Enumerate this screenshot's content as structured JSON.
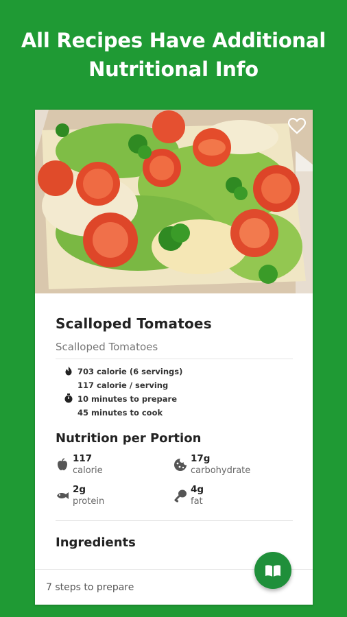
{
  "promo": {
    "line1": "All Recipes Have Additional",
    "line2": "Nutritional Info"
  },
  "recipe": {
    "title": "Scalloped Tomatoes",
    "subtitle": "Scalloped Tomatoes",
    "favorite_icon": "heart-outline-icon",
    "image_alt": "baked scalloped tomatoes dish"
  },
  "stats": {
    "total_calories": "703 calorie (6 servings)",
    "per_serving": "117 calorie / serving",
    "prep": "10 minutes to prepare",
    "cook": "45 minutes to cook",
    "calorie_icon": "flame-icon",
    "time_icon": "stopwatch-icon"
  },
  "nutrition": {
    "title": "Nutrition per Portion",
    "items": [
      {
        "value": "117",
        "label": "calorie",
        "icon": "apple-icon"
      },
      {
        "value": "17g",
        "label": "carbohydrate",
        "icon": "cookie-icon"
      },
      {
        "value": "2g",
        "label": "protein",
        "icon": "fish-icon"
      },
      {
        "value": "4g",
        "label": "fat",
        "icon": "drumstick-icon"
      }
    ]
  },
  "ingredients": {
    "title": "Ingredients"
  },
  "footer": {
    "steps": "7 steps to prepare",
    "fab_icon": "book-open-icon"
  },
  "colors": {
    "background": "#1f9a34",
    "fab": "#1f8f3a",
    "card": "#ffffff"
  }
}
